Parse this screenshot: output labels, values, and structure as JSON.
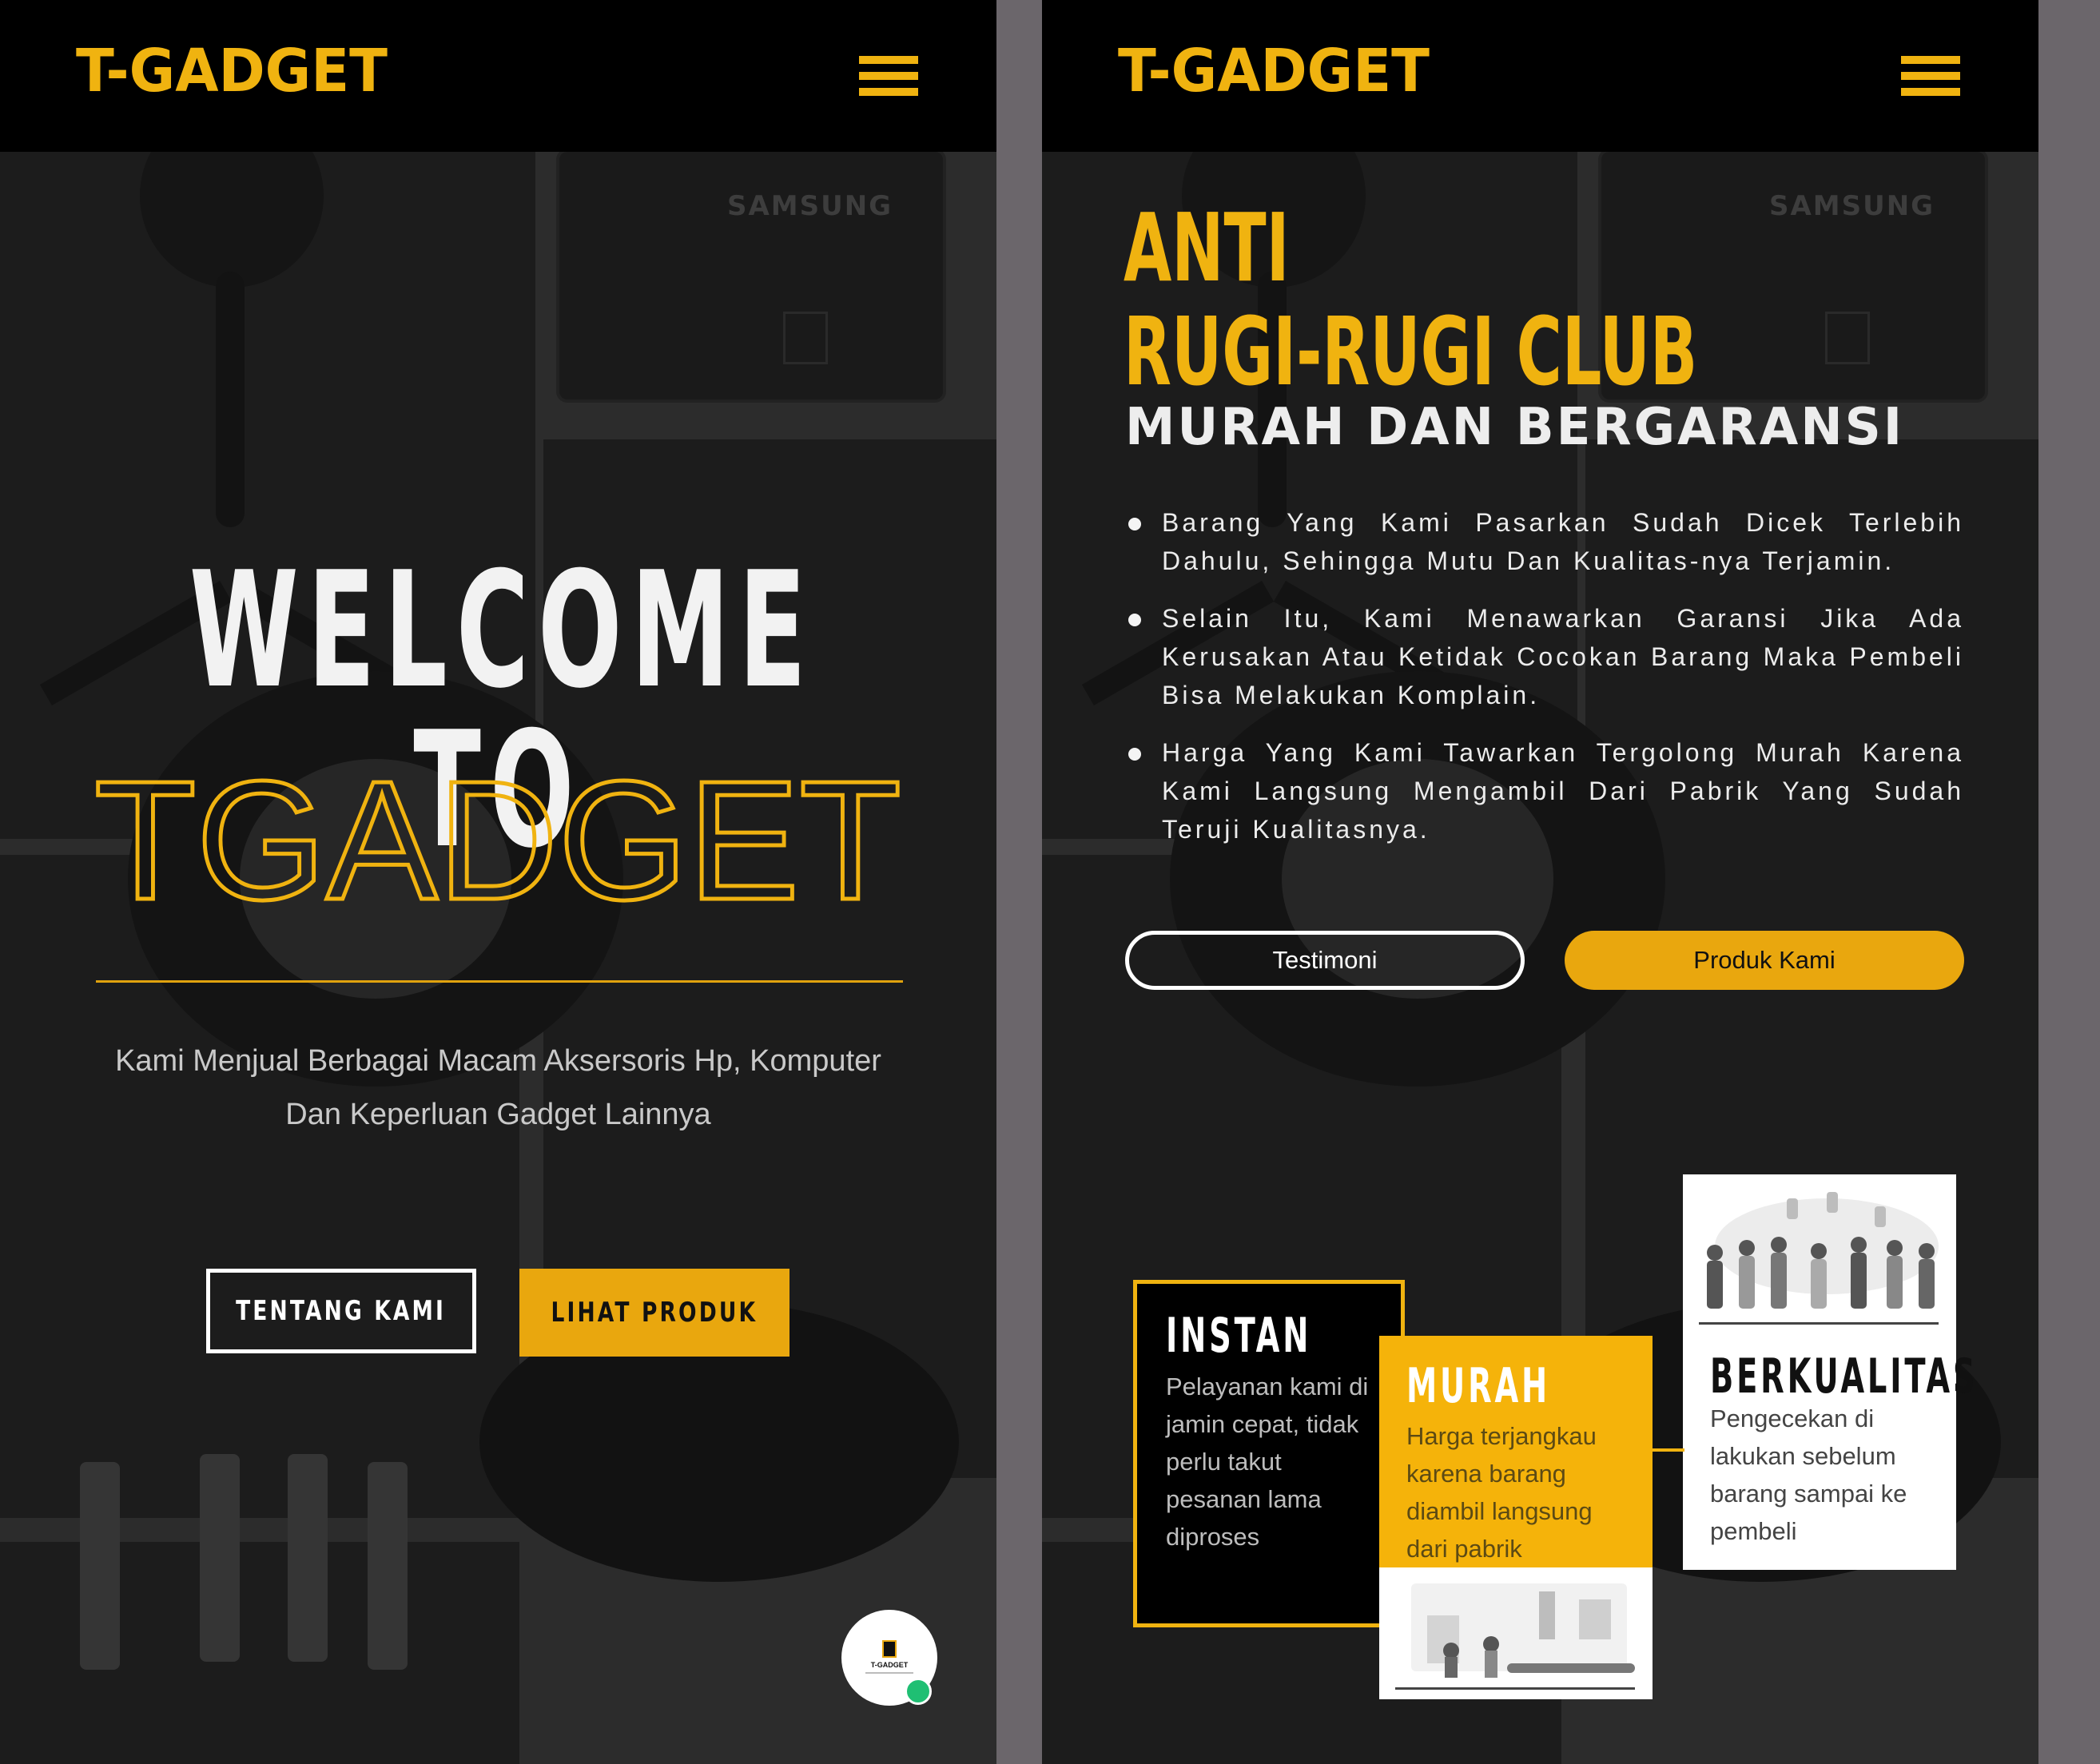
{
  "brand": {
    "logo_text": "T-GADGET",
    "accent_color": "#f0b310"
  },
  "left_screen": {
    "menu_icon": "hamburger-icon",
    "background_label": "SAMSUNG",
    "hero": {
      "welcome": "WELCOME TO",
      "brand_outline": "TGADGET",
      "tagline_line1": "Kami Menjual Berbagai Macam Aksersoris Hp, Komputer",
      "tagline_line2": "Dan Keperluan Gadget Lainnya"
    },
    "buttons": {
      "about": "TENTANG KAMI",
      "products": "LIHAT PRODUK"
    },
    "chat_widget": {
      "icon": "chat-avatar-icon",
      "mini_logo": "T-GADGET",
      "status_color": "#1fbf73"
    }
  },
  "right_screen": {
    "menu_icon": "hamburger-icon",
    "background_label": "SAMSUNG",
    "heading_line1": "ANTI",
    "heading_line2": "RUGI-RUGI CLUB",
    "subheading": "MURAH DAN BERGARANSI",
    "bullets": [
      "Barang Yang Kami Pasarkan Sudah Dicek Terlebih Dahulu, Sehingga Mutu Dan Kualitas-nya Terjamin.",
      "Selain Itu, Kami Menawarkan Garansi Jika Ada Kerusakan Atau Ketidak Cocokan Barang Maka Pembeli Bisa Melakukan Komplain.",
      "Harga Yang Kami Tawarkan Tergolong Murah Karena Kami Langsung Mengambil Dari Pabrik Yang Sudah Teruji Kualitasnya."
    ],
    "buttons": {
      "testimonials": "Testimoni",
      "our_products": "Produk Kami"
    },
    "features": [
      {
        "title": "INSTAN",
        "text": "Pelayanan kami di jamin cepat, tidak perlu takut pesanan lama diproses"
      },
      {
        "title": "MURAH",
        "text": "Harga terjangkau karena barang diambil langsung dari pabrik",
        "illustration": "factory-illustration"
      },
      {
        "title": "BERKUALITAS",
        "text": "Pengecekan di lakukan sebelum barang sampai ke pembeli",
        "illustration": "team-illustration"
      }
    ]
  }
}
